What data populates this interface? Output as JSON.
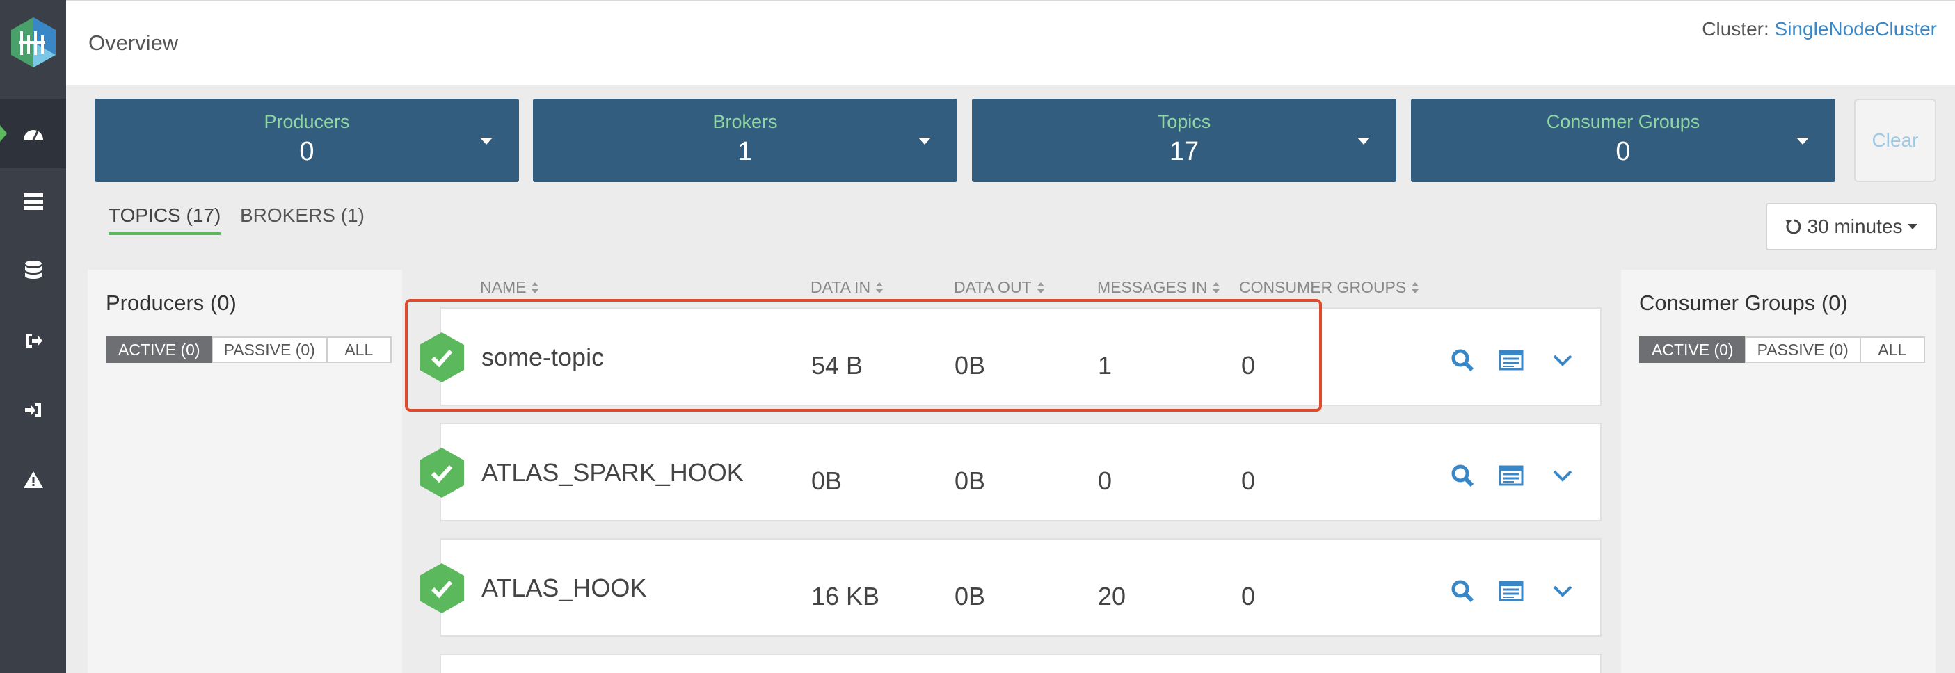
{
  "header": {
    "title": "Overview",
    "cluster_label": "Cluster: ",
    "cluster_name": "SingleNodeCluster"
  },
  "cards": [
    {
      "label": "Producers",
      "value": "0"
    },
    {
      "label": "Brokers",
      "value": "1"
    },
    {
      "label": "Topics",
      "value": "17"
    },
    {
      "label": "Consumer Groups",
      "value": "0"
    }
  ],
  "clear_label": "Clear",
  "tabs": [
    {
      "label": "TOPICS (17)",
      "active": true
    },
    {
      "label": "BROKERS (1)",
      "active": false
    }
  ],
  "time_range": "30 minutes",
  "producers_panel": {
    "title": "Producers (0)",
    "filters": [
      "ACTIVE (0)",
      "PASSIVE (0)",
      "ALL"
    ]
  },
  "consumers_panel": {
    "title": "Consumer Groups (0)",
    "filters": [
      "ACTIVE (0)",
      "PASSIVE (0)",
      "ALL"
    ]
  },
  "columns": [
    "NAME",
    "DATA IN",
    "DATA OUT",
    "MESSAGES IN",
    "CONSUMER GROUPS"
  ],
  "topics": [
    {
      "name": "some-topic",
      "data_in": "54 B",
      "data_out": "0B",
      "messages_in": "1",
      "consumer_groups": "0"
    },
    {
      "name": "ATLAS_SPARK_HOOK",
      "data_in": "0B",
      "data_out": "0B",
      "messages_in": "0",
      "consumer_groups": "0"
    },
    {
      "name": "ATLAS_HOOK",
      "data_in": "16 KB",
      "data_out": "0B",
      "messages_in": "20",
      "consumer_groups": "0"
    }
  ],
  "colors": {
    "accent": "#5cb85c",
    "card_bg": "#335d7e",
    "link": "#3a87c7",
    "highlight": "#e04a2c"
  }
}
